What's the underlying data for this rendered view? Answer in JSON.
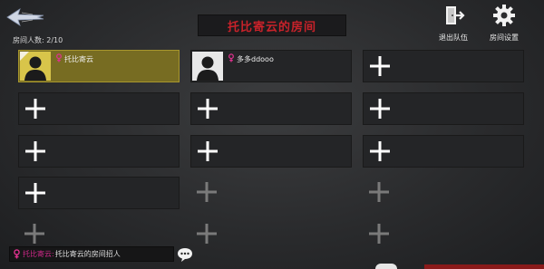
{
  "header": {
    "room_title": "托比寄云的房间",
    "room_count_label": "房间人数: 2/10",
    "exit_team_label": "退出队伍",
    "room_settings_label": "房间设置",
    "back_icon": "back-arrow-icon",
    "exit_icon": "exit-door-icon",
    "settings_icon": "gear-icon"
  },
  "slots": [
    {
      "state": "self",
      "name": "托比寄云",
      "gender": "female",
      "is_host": true
    },
    {
      "state": "player",
      "name": "多多ddooo",
      "gender": "female",
      "is_host": false
    },
    {
      "state": "open"
    },
    {
      "state": "open"
    },
    {
      "state": "open"
    },
    {
      "state": "open"
    },
    {
      "state": "open"
    },
    {
      "state": "open"
    },
    {
      "state": "open"
    },
    {
      "state": "open"
    },
    {
      "state": "disabled"
    },
    {
      "state": "disabled"
    },
    {
      "state": "disabled"
    },
    {
      "state": "disabled"
    },
    {
      "state": "disabled"
    }
  ],
  "chat": {
    "sender": "托比寄云:",
    "message": "托比寄云的房间招人",
    "chat_icon": "chat-bubble-icon"
  },
  "colors": {
    "title_red": "#c8222a",
    "self_slot": "#776c22",
    "female_pink": "#e0318f"
  }
}
